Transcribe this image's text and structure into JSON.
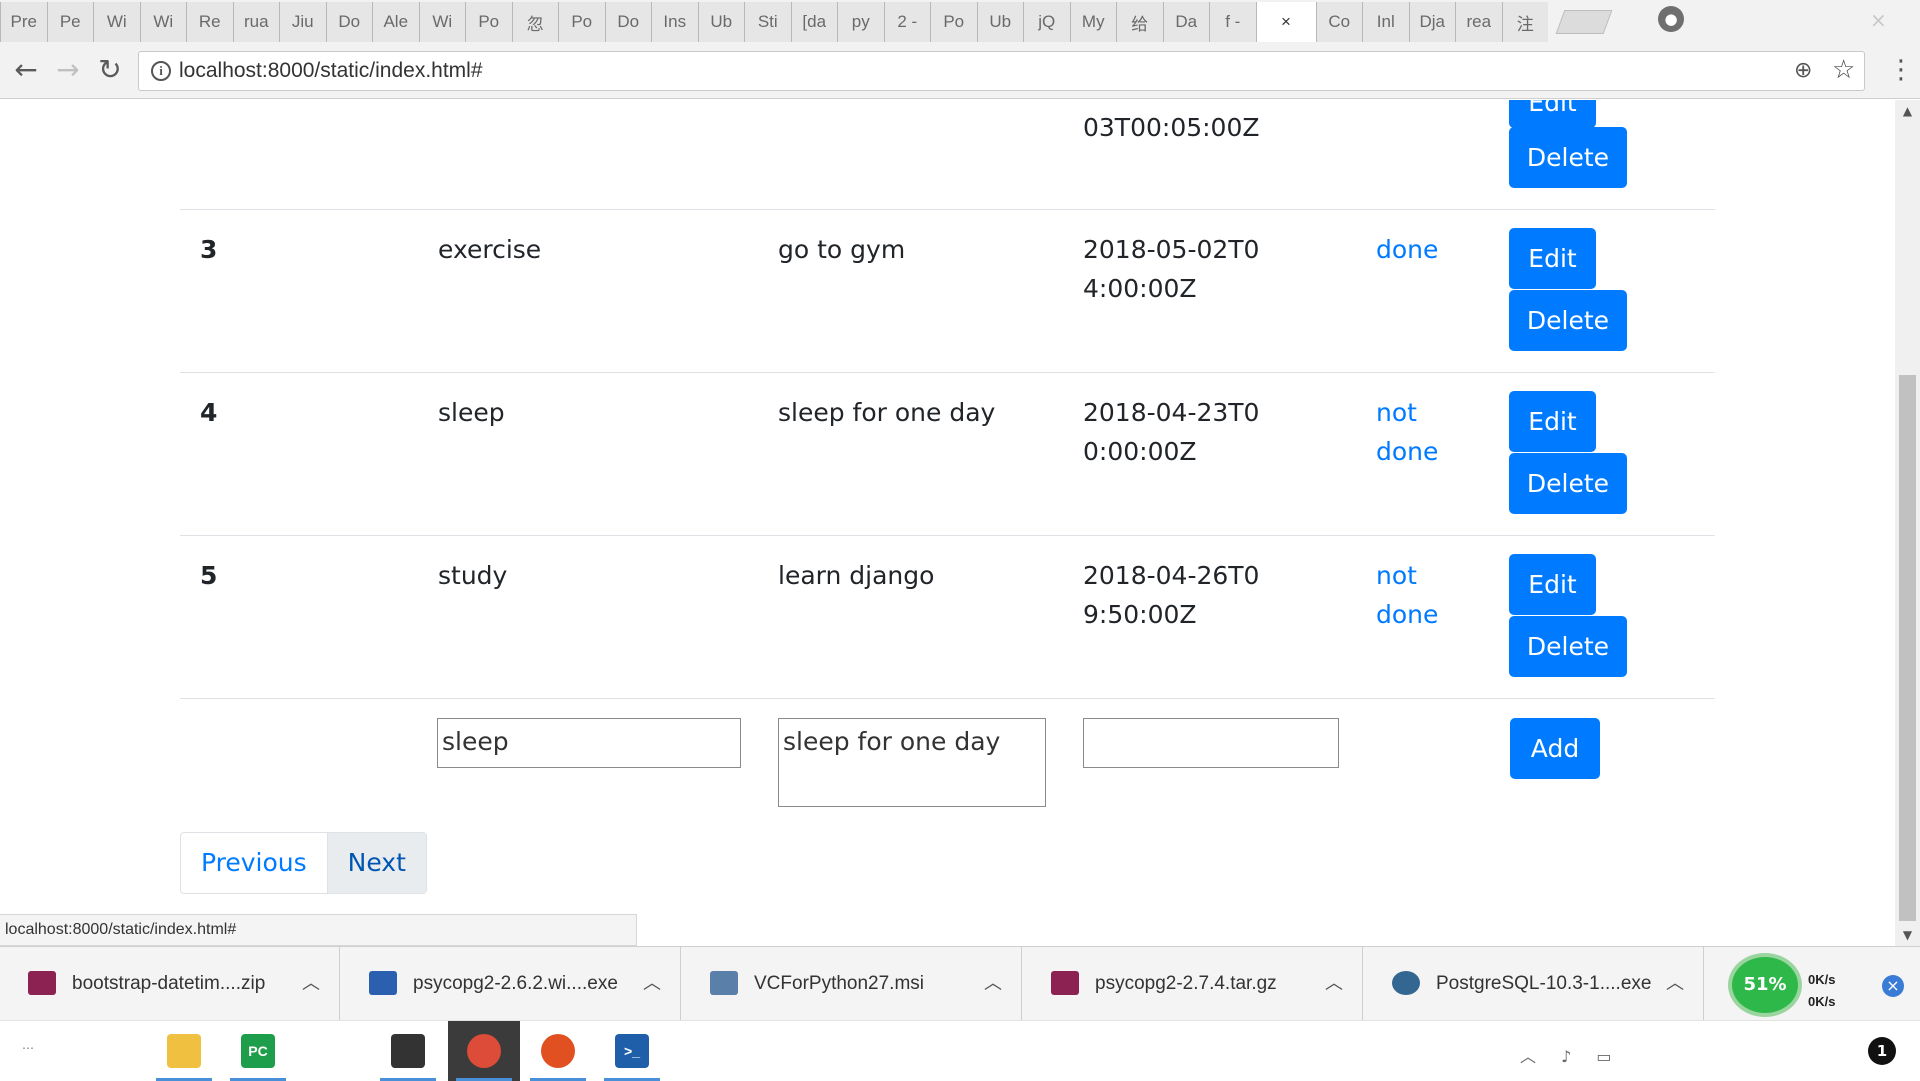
{
  "browser": {
    "tabs": [
      "Pre",
      "Pe",
      "Wi",
      "Wi",
      "Re",
      "rua",
      "Jiu",
      "Do",
      "Ale",
      "Wi",
      "Po",
      "忽",
      "Po",
      "Do",
      "Ins",
      "Ub",
      "Sti",
      "[da",
      "py",
      "2 -",
      "Po",
      "Ub",
      "jQ",
      "My",
      "给",
      "Da",
      "f -",
      "",
      "Co",
      "Inl",
      "Dja",
      "rea",
      "注"
    ],
    "active_tab_close": "×",
    "window_close": "×",
    "url": "localhost:8000/static/index.html#",
    "nav": {
      "back": "←",
      "forward": "→",
      "reload": "↻"
    },
    "omnibox_icons": {
      "info": "i",
      "zoom": "⊕",
      "star": "☆",
      "menu": "⋮"
    },
    "profile": "●"
  },
  "table": {
    "partial_row": {
      "date_tail": "03T00:05:00Z",
      "edit_label": "Edit",
      "delete_label": "Delete"
    },
    "rows": [
      {
        "id": "3",
        "title": "exercise",
        "description": "go to gym",
        "date": "2018-05-02T04:00:00Z",
        "status": "done",
        "edit_label": "Edit",
        "delete_label": "Delete"
      },
      {
        "id": "4",
        "title": "sleep",
        "description": "sleep for one day",
        "date": "2018-04-23T00:00:00Z",
        "status": "not done",
        "edit_label": "Edit",
        "delete_label": "Delete"
      },
      {
        "id": "5",
        "title": "study",
        "description": "learn django",
        "date": "2018-04-26T09:50:00Z",
        "status": "not done",
        "edit_label": "Edit",
        "delete_label": "Delete"
      }
    ],
    "form": {
      "title_value": "sleep",
      "description_value": "sleep for one day",
      "date_value": "",
      "add_label": "Add"
    }
  },
  "pagination": {
    "previous": "Previous",
    "next": "Next"
  },
  "status_bar": "localhost:8000/static/index.html#",
  "downloads": [
    {
      "name": "bootstrap-datetim....zip",
      "color": "#8b2252"
    },
    {
      "name": "psycopg2-2.6.2.wi....exe",
      "color": "#2b5fb0"
    },
    {
      "name": "VCForPython27.msi",
      "color": "#5a7fa8"
    },
    {
      "name": "psycopg2-2.7.4.tar.gz",
      "color": "#8b2252"
    },
    {
      "name": "PostgreSQL-10.3-1....exe",
      "color": "#336791"
    }
  ],
  "net_meter": {
    "percent": "51%",
    "up": "0K/s",
    "down": "0K/s"
  },
  "taskbar": {
    "apps": [
      {
        "label": "",
        "color": "#f0c040"
      },
      {
        "label": "PC",
        "color": "#1e9e4a"
      },
      {
        "label": "",
        "color": "#333333"
      },
      {
        "label": "",
        "color": "#dd4b39"
      },
      {
        "label": "",
        "color": "#e05020"
      },
      {
        "label": ">_",
        "color": "#1f5faa"
      }
    ],
    "notifications": "1"
  },
  "colors": {
    "primary": "#007bff",
    "link": "#007bff",
    "border": "#dee2e6"
  }
}
